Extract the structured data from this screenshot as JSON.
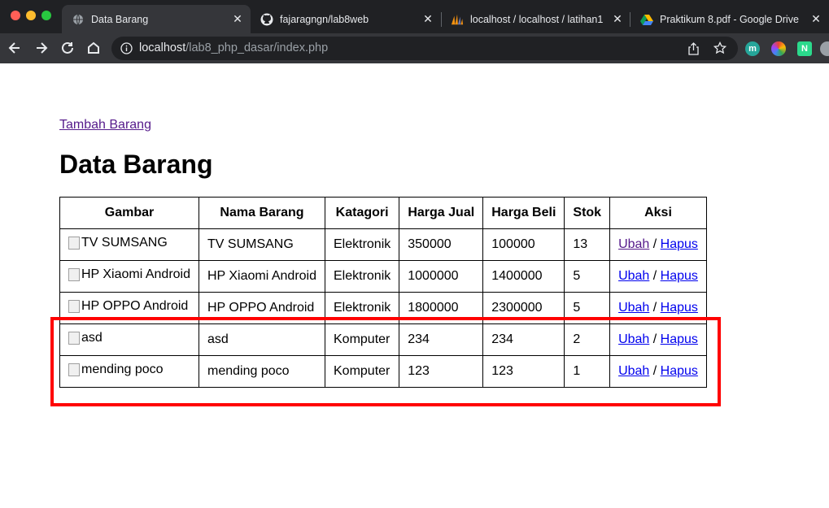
{
  "browser": {
    "tabs": [
      {
        "title": "Data Barang",
        "icon": "globe-icon",
        "active": true
      },
      {
        "title": "fajaragngn/lab8web",
        "icon": "github-icon",
        "active": false
      },
      {
        "title": "localhost / localhost / latihan1",
        "icon": "phpmyadmin-icon",
        "active": false
      },
      {
        "title": "Praktikum 8.pdf - Google Drive",
        "icon": "google-drive-icon",
        "active": false
      }
    ],
    "url_host": "localhost",
    "url_path": "/lab8_php_dasar/index.php",
    "extensions": [
      "m",
      "N"
    ]
  },
  "page": {
    "add_link": "Tambah Barang",
    "title": "Data Barang",
    "columns": [
      "Gambar",
      "Nama Barang",
      "Katagori",
      "Harga Jual",
      "Harga Beli",
      "Stok",
      "Aksi"
    ],
    "rows": [
      {
        "gambar_alt": "TV SUMSANG",
        "nama": "TV SUMSANG",
        "kategori": "Elektronik",
        "harga_jual": "350000",
        "harga_beli": "100000",
        "stok": "13",
        "ubah": "Ubah",
        "sep": "/",
        "hapus": "Hapus"
      },
      {
        "gambar_alt": "HP Xiaomi Android",
        "nama": "HP Xiaomi Android",
        "kategori": "Elektronik",
        "harga_jual": "1000000",
        "harga_beli": "1400000",
        "stok": "5",
        "ubah": "Ubah",
        "sep": "/",
        "hapus": "Hapus"
      },
      {
        "gambar_alt": "HP OPPO Android",
        "nama": "HP OPPO Android",
        "kategori": "Elektronik",
        "harga_jual": "1800000",
        "harga_beli": "2300000",
        "stok": "5",
        "ubah": "Ubah",
        "sep": "/",
        "hapus": "Hapus"
      },
      {
        "gambar_alt": "asd",
        "nama": "asd",
        "kategori": "Komputer",
        "harga_jual": "234",
        "harga_beli": "234",
        "stok": "2",
        "ubah": "Ubah",
        "sep": "/",
        "hapus": "Hapus"
      },
      {
        "gambar_alt": "mending poco",
        "nama": "mending poco",
        "kategori": "Komputer",
        "harga_jual": "123",
        "harga_beli": "123",
        "stok": "1",
        "ubah": "Ubah",
        "sep": "/",
        "hapus": "Hapus"
      }
    ]
  },
  "colors": {
    "highlight": "#ff0000",
    "link": "#0000ee",
    "visited_link": "#551a8b"
  }
}
